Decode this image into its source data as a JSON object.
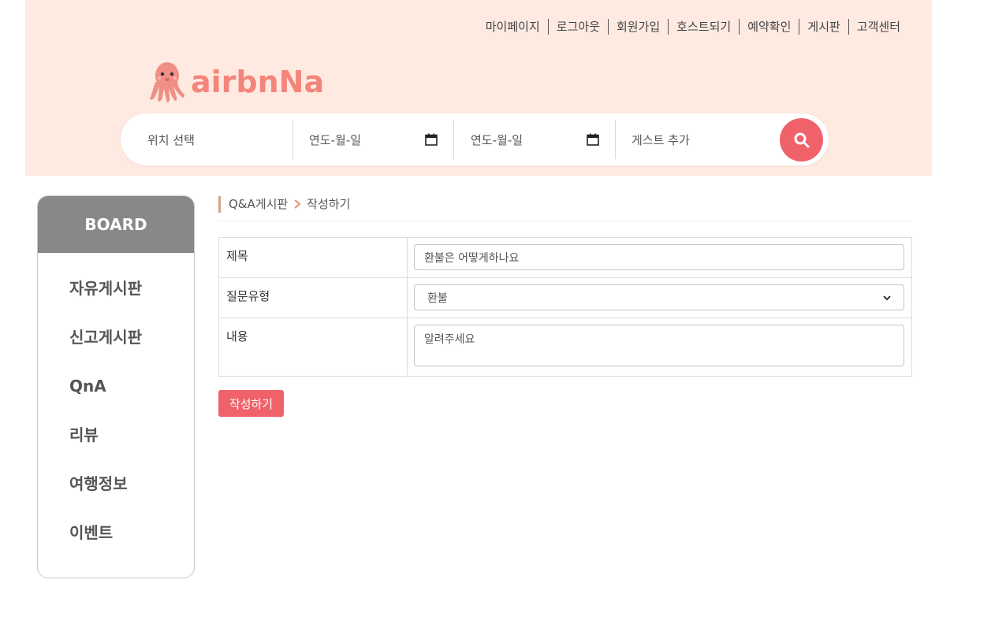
{
  "colors": {
    "header_bg": "#ffeae2",
    "accent": "#f0626a",
    "logo": "#f3857a",
    "sidebar_head": "#888888"
  },
  "topnav": {
    "items": [
      "마이페이지",
      "로그아웃",
      "회원가입",
      "호스트되기",
      "예약확인",
      "게시판",
      "고객센터"
    ]
  },
  "logo": {
    "text": "airbnNa",
    "icon": "octopus-icon"
  },
  "search": {
    "location_placeholder": "위치 선택",
    "checkin_placeholder": "연도-월-일",
    "checkout_placeholder": "연도-월-일",
    "guest_placeholder": "게스트 추가",
    "calendar_icon": "calendar-icon",
    "button_icon": "search-icon"
  },
  "sidebar": {
    "title": "BOARD",
    "items": [
      "자유게시판",
      "신고게시판",
      "QnA",
      "리뷰",
      "여행정보",
      "이벤트"
    ]
  },
  "breadcrumb": {
    "parent": "Q&A게시판",
    "separator_icon": "chevron-right-icon",
    "current": "작성하기"
  },
  "form": {
    "title_label": "제목",
    "title_value": "환불은 어떻게하나요",
    "type_label": "질문유형",
    "type_value": "환불",
    "content_label": "내용",
    "content_value": "알려주세요",
    "submit_label": "작성하기"
  }
}
